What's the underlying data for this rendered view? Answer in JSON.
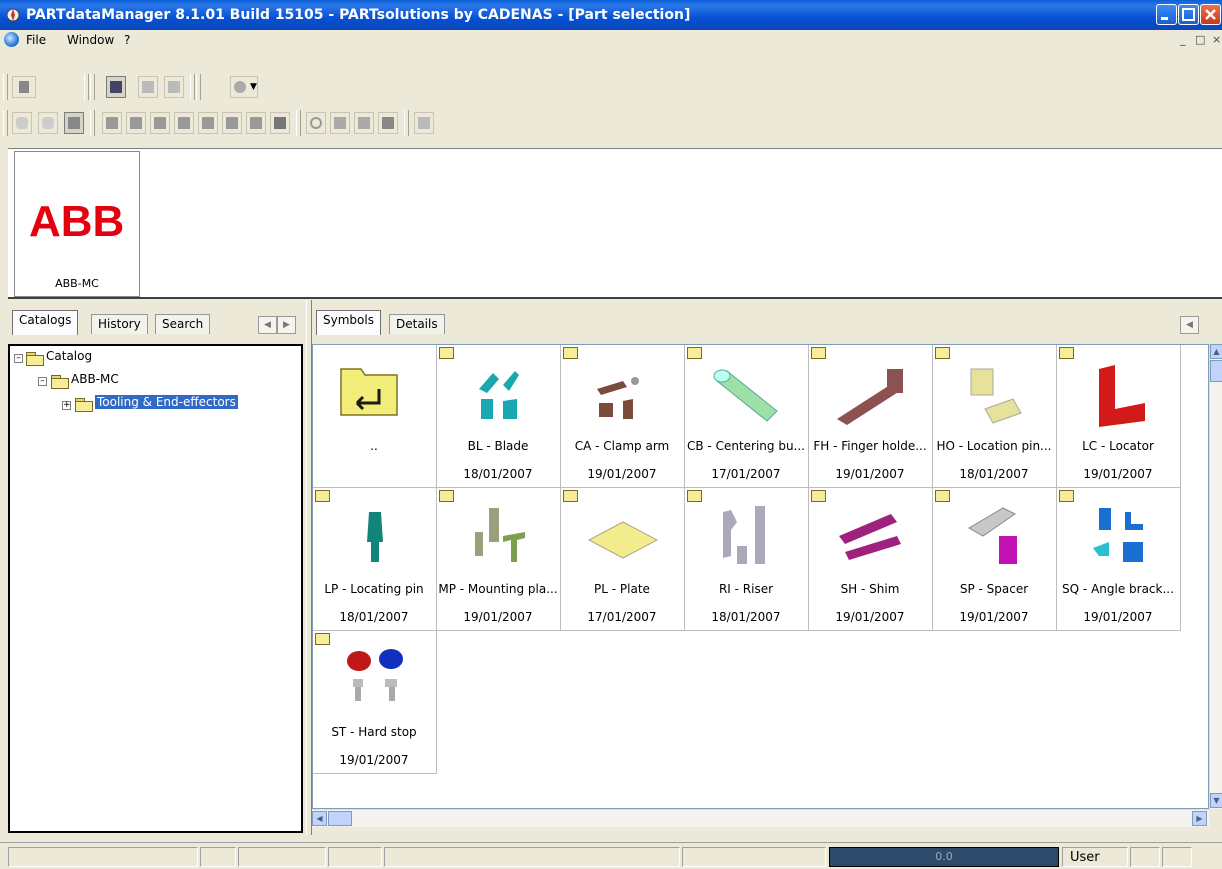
{
  "window": {
    "title": "PARTdataManager 8.1.01 Build 15105 - PARTsolutions by CADENAS - [Part selection]"
  },
  "menu": {
    "items": [
      "File",
      "Window",
      "?"
    ],
    "mnemonics": [
      "F",
      "W",
      "?"
    ]
  },
  "catalog_bar": {
    "logo_text": "ABB",
    "label": "ABB-MC"
  },
  "left_tabs": [
    "Catalogs",
    "History",
    "Search"
  ],
  "tree": {
    "root": "Catalog",
    "child": "ABB-MC",
    "grandchild": "Tooling & End-effectors"
  },
  "right_tabs": [
    "Symbols",
    "Details"
  ],
  "parent_item": {
    "name": ".."
  },
  "items": [
    {
      "name": "BL - Blade",
      "date": "18/01/2007",
      "color": "#1aa8b0"
    },
    {
      "name": "CA - Clamp arm",
      "date": "19/01/2007",
      "color": "#7a4b3b"
    },
    {
      "name": "CB - Centering bu...",
      "date": "17/01/2007",
      "color": "#9ee0a6"
    },
    {
      "name": "FH - Finger holde...",
      "date": "19/01/2007",
      "color": "#8c5252"
    },
    {
      "name": "HO - Location pin...",
      "date": "18/01/2007",
      "color": "#e6e29a"
    },
    {
      "name": "LC - Locator",
      "date": "19/01/2007",
      "color": "#d21a1a"
    },
    {
      "name": "LP - Locating pin",
      "date": "18/01/2007",
      "color": "#12857a"
    },
    {
      "name": "MP - Mounting pla...",
      "date": "19/01/2007",
      "color": "#9aa07e"
    },
    {
      "name": "PL - Plate",
      "date": "17/01/2007",
      "color": "#f2ec8c"
    },
    {
      "name": "RI - Riser",
      "date": "18/01/2007",
      "color": "#a9a9b9"
    },
    {
      "name": "SH - Shim",
      "date": "19/01/2007",
      "color": "#a0207e"
    },
    {
      "name": "SP - Spacer",
      "date": "19/01/2007",
      "color": "#c012b0"
    },
    {
      "name": "SQ - Angle brack...",
      "date": "19/01/2007",
      "color": "#1a70d0"
    },
    {
      "name": "ST - Hard stop",
      "date": "19/01/2007",
      "color": "#c01818"
    }
  ],
  "status": {
    "progress_text": "0.0",
    "progress_value": 0,
    "user": "User"
  }
}
